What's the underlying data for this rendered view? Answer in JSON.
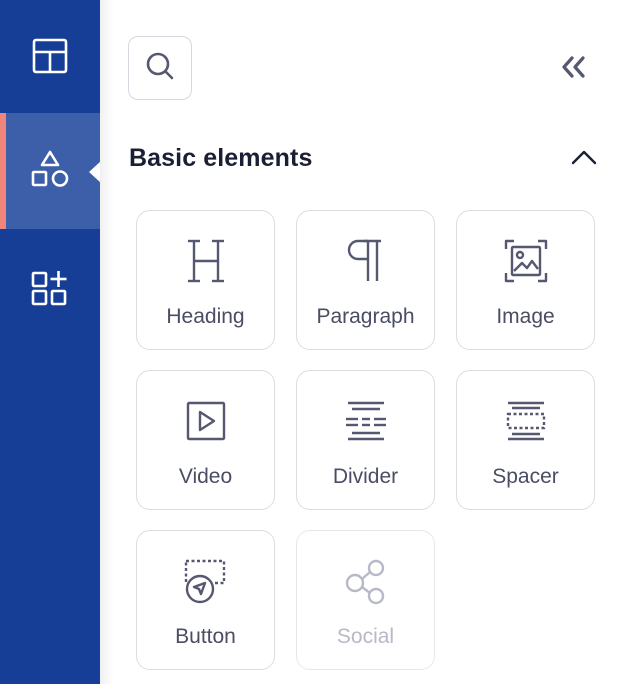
{
  "rail": {
    "items": [
      {
        "icon": "layout-icon",
        "active": false
      },
      {
        "icon": "shapes-icon",
        "active": true
      },
      {
        "icon": "add-widget-icon",
        "active": false
      }
    ]
  },
  "panel": {
    "section_title": "Basic elements",
    "elements": [
      {
        "label": "Heading",
        "icon": "heading-icon",
        "disabled": false
      },
      {
        "label": "Paragraph",
        "icon": "paragraph-icon",
        "disabled": false
      },
      {
        "label": "Image",
        "icon": "image-icon",
        "disabled": false
      },
      {
        "label": "Video",
        "icon": "video-icon",
        "disabled": false
      },
      {
        "label": "Divider",
        "icon": "divider-icon",
        "disabled": false
      },
      {
        "label": "Spacer",
        "icon": "spacer-icon",
        "disabled": false
      },
      {
        "label": "Button",
        "icon": "button-icon",
        "disabled": false
      },
      {
        "label": "Social",
        "icon": "social-icon",
        "disabled": true
      }
    ]
  },
  "colors": {
    "rail_bg": "#163e96",
    "rail_active_bg": "#3d5ea8",
    "active_marker": "#f0857c",
    "icon_stroke": "#555870",
    "disabled_stroke": "#b7b9c7"
  }
}
